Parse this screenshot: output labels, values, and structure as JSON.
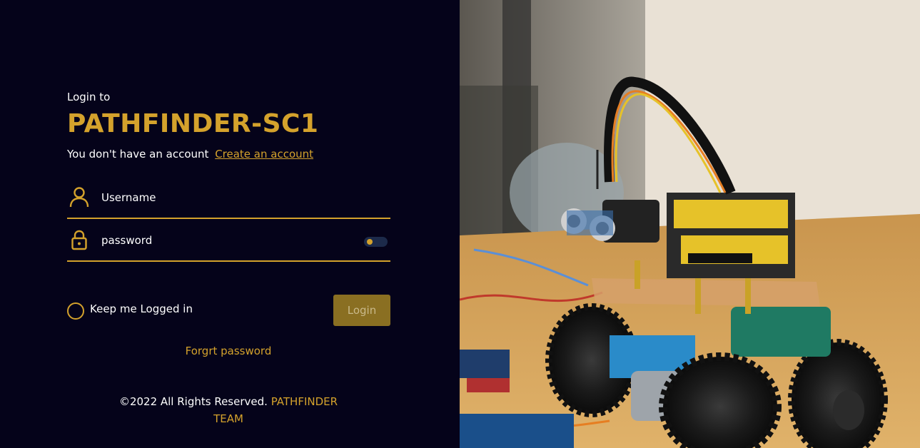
{
  "login": {
    "heading_small": "Login to",
    "app_name": "PATHFINDER-SC1",
    "no_account_text": "You don't have an account",
    "create_account_link": "Create an account",
    "username_placeholder": "Username",
    "password_placeholder": "password",
    "keep_logged_in": "Keep me Logged in",
    "login_button": "Login",
    "forgot_password": "Forgrt password"
  },
  "footer": {
    "copyright": "©2022 All Rights Reserved.",
    "team": "PATHFINDER TEAM"
  },
  "icons": {
    "username": "user-icon",
    "password": "lock-icon",
    "toggle": "show-password-toggle"
  },
  "colors": {
    "background": "#05031a",
    "accent": "#d4a22c",
    "button": "#8a6f22"
  },
  "hero_image": "robot-car-photo"
}
